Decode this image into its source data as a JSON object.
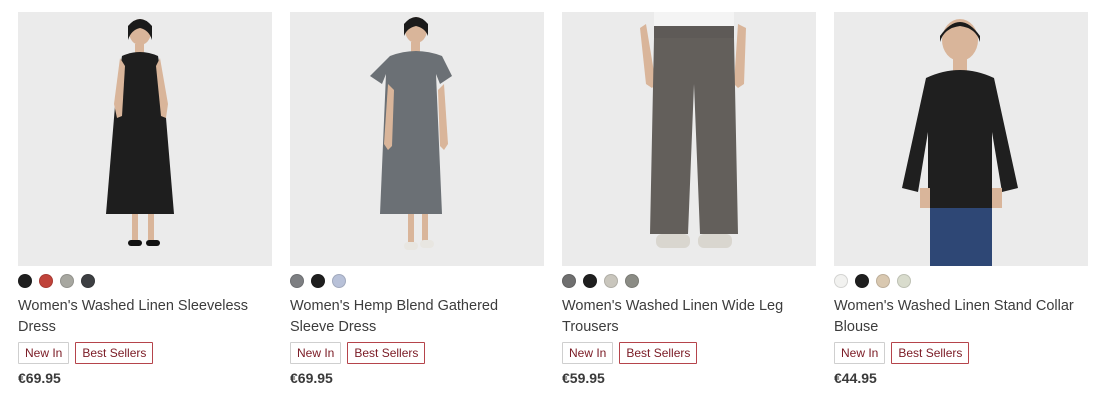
{
  "products": [
    {
      "title": "Women's Washed Linen Sleeveless Dress",
      "badges": [
        "New In",
        "Best Sellers"
      ],
      "price": "€69.95",
      "image": "model-black-sleeveless-dress",
      "swatches": [
        "#1f1f1f",
        "#c0433a",
        "#a7a7a0",
        "#3d3f42"
      ]
    },
    {
      "title": "Women's Hemp Blend Gathered Sleeve Dress",
      "badges": [
        "New In",
        "Best Sellers"
      ],
      "price": "€69.95",
      "image": "model-grey-gathered-sleeve-dress",
      "swatches": [
        "#7d7f82",
        "#1f1f1f",
        "#b8c1d8"
      ]
    },
    {
      "title": "Women's Washed Linen Wide Leg Trousers",
      "badges": [
        "New In",
        "Best Sellers"
      ],
      "price": "€59.95",
      "image": "model-grey-wide-leg-trousers",
      "swatches": [
        "#6f6f6f",
        "#1f1f1f",
        "#c9c6bd",
        "#8b8c85"
      ]
    },
    {
      "title": "Women's Washed Linen Stand Collar Blouse",
      "badges": [
        "New In",
        "Best Sellers"
      ],
      "price": "€44.95",
      "image": "model-black-stand-collar-blouse",
      "swatches": [
        "#f2f2f0",
        "#1f1f1f",
        "#d9c8b0",
        "#d9dccd"
      ]
    }
  ],
  "colors": {
    "badge_border": "#b5444b",
    "badge_text": "#7a1a24",
    "photo_background": "#ebebeb"
  }
}
